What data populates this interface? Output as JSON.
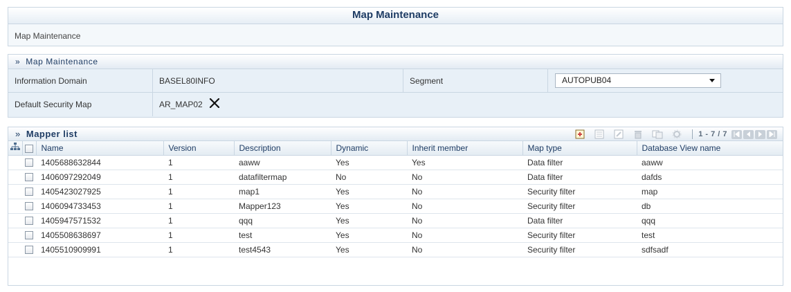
{
  "header": {
    "title": "Map Maintenance",
    "breadcrumb": "Map Maintenance"
  },
  "map_maintenance": {
    "section_title": "Map Maintenance",
    "information_domain_label": "Information Domain",
    "information_domain_value": "BASEL80INFO",
    "segment_label": "Segment",
    "segment_value": "AUTOPUB04",
    "default_security_map_label": "Default Security Map",
    "default_security_map_value": "AR_MAP02"
  },
  "mapper_list": {
    "section_title": "Mapper list",
    "pager_text": "1 - 7 / 7",
    "toolbar_icons": [
      "add-icon",
      "view-icon",
      "edit-icon",
      "delete-icon",
      "copy-icon",
      "settings-icon"
    ],
    "columns": [
      "Name",
      "Version",
      "Description",
      "Dynamic",
      "Inherit member",
      "Map type",
      "Database View name"
    ],
    "rows": [
      {
        "name": "1405688632844",
        "version": "1",
        "description": "aaww",
        "dynamic": "Yes",
        "inherit": "Yes",
        "map_type": "Data filter",
        "db_view": "aaww"
      },
      {
        "name": "1406097292049",
        "version": "1",
        "description": "datafiltermap",
        "dynamic": "No",
        "inherit": "No",
        "map_type": "Data filter",
        "db_view": "dafds"
      },
      {
        "name": "1405423027925",
        "version": "1",
        "description": "map1",
        "dynamic": "Yes",
        "inherit": "No",
        "map_type": "Security filter",
        "db_view": "map"
      },
      {
        "name": "1406094733453",
        "version": "1",
        "description": "Mapper123",
        "dynamic": "Yes",
        "inherit": "No",
        "map_type": "Security filter",
        "db_view": "db"
      },
      {
        "name": "1405947571532",
        "version": "1",
        "description": "qqq",
        "dynamic": "Yes",
        "inherit": "No",
        "map_type": "Data filter",
        "db_view": "qqq"
      },
      {
        "name": "1405508638697",
        "version": "1",
        "description": "test",
        "dynamic": "Yes",
        "inherit": "No",
        "map_type": "Security filter",
        "db_view": "test"
      },
      {
        "name": "1405510909991",
        "version": "1",
        "description": "test4543",
        "dynamic": "Yes",
        "inherit": "No",
        "map_type": "Security filter",
        "db_view": "sdfsadf"
      }
    ]
  }
}
